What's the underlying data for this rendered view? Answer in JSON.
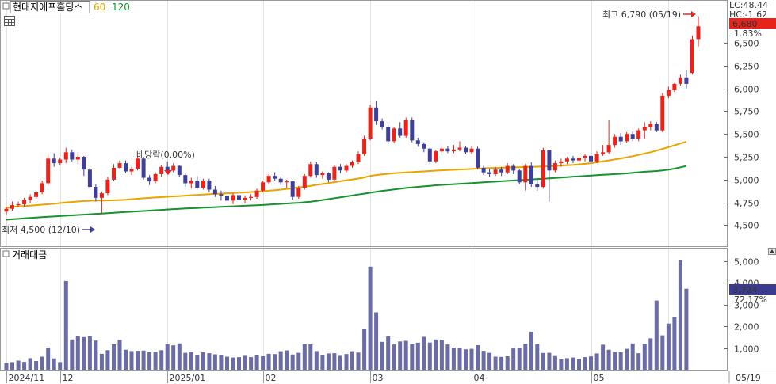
{
  "header": {
    "stock_name": "현대지에프홀딩스",
    "ma60_label": "60",
    "ma120_label": "120",
    "checkbox_icon": "checkbox-icon",
    "table_icon": "table-grid-icon"
  },
  "price_panel": {
    "lc_text": "LC:48.44",
    "hc_text": "HC:-1.62",
    "current_price": "6,680",
    "current_change": "1.83%",
    "high_annotation": "최고 6,790 (05/19)",
    "low_annotation": "최저 4,500 (12/10)",
    "dividend_annotation": "배당락(0.00%)"
  },
  "volume_panel": {
    "title": "거래대금",
    "current_value": "3,724",
    "current_change": "72.17%"
  },
  "colors": {
    "up": "#e8231b",
    "down": "#3f3f9a",
    "ma60": "#e8a400",
    "ma120": "#16922e",
    "volume_bar": "#6b6ba5",
    "price_tag_bg": "#e8231b",
    "volume_tag_bg": "#3b3b8f"
  },
  "chart_data": {
    "type": "candlestick",
    "price_axis": {
      "ticks": [
        4500,
        4750,
        5000,
        5250,
        5500,
        5750,
        6000,
        6250,
        6500
      ],
      "range": [
        4330,
        6900
      ]
    },
    "volume_axis": {
      "ticks": [
        1000,
        2000,
        3000,
        4000,
        5000
      ],
      "range": [
        0,
        5350
      ]
    },
    "x_labels": [
      {
        "label": "2024/11",
        "index": 0
      },
      {
        "label": "12",
        "index": 9
      },
      {
        "label": "2025/01",
        "index": 27
      },
      {
        "label": "02",
        "index": 43
      },
      {
        "label": "03",
        "index": 61
      },
      {
        "label": "04",
        "index": 78
      },
      {
        "label": "05",
        "index": 98
      },
      {
        "label": "05/19",
        "index": 111
      }
    ],
    "candles": [
      [
        4650,
        4700,
        4620,
        4680
      ],
      [
        4680,
        4760,
        4660,
        4720
      ],
      [
        4720,
        4760,
        4700,
        4730
      ],
      [
        4730,
        4800,
        4700,
        4780
      ],
      [
        4780,
        4840,
        4740,
        4810
      ],
      [
        4810,
        4880,
        4790,
        4860
      ],
      [
        4860,
        4990,
        4840,
        4960
      ],
      [
        4960,
        5270,
        4940,
        5230
      ],
      [
        5230,
        5290,
        5140,
        5180
      ],
      [
        5180,
        5240,
        5160,
        5220
      ],
      [
        5220,
        5350,
        5180,
        5300
      ],
      [
        5300,
        5330,
        5200,
        5220
      ],
      [
        5220,
        5280,
        5170,
        5250
      ],
      [
        5250,
        5260,
        5040,
        5110
      ],
      [
        5110,
        5130,
        4900,
        4920
      ],
      [
        4920,
        4950,
        4760,
        4800
      ],
      [
        4800,
        4870,
        4630,
        4850
      ],
      [
        4850,
        5030,
        4830,
        5000
      ],
      [
        5000,
        5170,
        4990,
        5130
      ],
      [
        5130,
        5210,
        5120,
        5180
      ],
      [
        5180,
        5210,
        5070,
        5090
      ],
      [
        5090,
        5140,
        5050,
        5120
      ],
      [
        5120,
        5260,
        5100,
        5230
      ],
      [
        5230,
        5250,
        5000,
        5020
      ],
      [
        5020,
        5050,
        4940,
        4980
      ],
      [
        4980,
        5080,
        4960,
        5060
      ],
      [
        5060,
        5160,
        5030,
        5140
      ],
      [
        5140,
        5200,
        5070,
        5100
      ],
      [
        5100,
        5180,
        5080,
        5150
      ],
      [
        5150,
        5160,
        5030,
        5050
      ],
      [
        5050,
        5070,
        4920,
        4960
      ],
      [
        4960,
        5020,
        4900,
        4990
      ],
      [
        4990,
        5040,
        4900,
        4910
      ],
      [
        4910,
        5010,
        4890,
        4990
      ],
      [
        4990,
        5010,
        4860,
        4890
      ],
      [
        4890,
        4930,
        4810,
        4840
      ],
      [
        4840,
        4880,
        4770,
        4820
      ],
      [
        4820,
        4860,
        4760,
        4770
      ],
      [
        4770,
        4850,
        4730,
        4830
      ],
      [
        4830,
        4850,
        4760,
        4780
      ],
      [
        4780,
        4820,
        4740,
        4800
      ],
      [
        4800,
        4840,
        4770,
        4810
      ],
      [
        4810,
        4900,
        4790,
        4880
      ],
      [
        4880,
        4990,
        4860,
        4970
      ],
      [
        4970,
        5060,
        4950,
        5040
      ],
      [
        5040,
        5080,
        4990,
        5010
      ],
      [
        5010,
        5030,
        4940,
        4970
      ],
      [
        4970,
        5000,
        4910,
        4980
      ],
      [
        4980,
        4990,
        4780,
        4810
      ],
      [
        4810,
        4930,
        4790,
        4910
      ],
      [
        4910,
        5060,
        4890,
        5040
      ],
      [
        5040,
        5200,
        5020,
        5170
      ],
      [
        5170,
        5190,
        5020,
        5050
      ],
      [
        5050,
        5090,
        5010,
        5070
      ],
      [
        5070,
        5080,
        4970,
        5000
      ],
      [
        5000,
        5160,
        4980,
        5140
      ],
      [
        5140,
        5170,
        5070,
        5100
      ],
      [
        5100,
        5170,
        5080,
        5150
      ],
      [
        5150,
        5210,
        5130,
        5190
      ],
      [
        5190,
        5310,
        5170,
        5280
      ],
      [
        5280,
        5480,
        5260,
        5450
      ],
      [
        5450,
        5820,
        5430,
        5790
      ],
      [
        5790,
        5860,
        5600,
        5640
      ],
      [
        5640,
        5670,
        5550,
        5580
      ],
      [
        5580,
        5600,
        5390,
        5420
      ],
      [
        5420,
        5580,
        5400,
        5560
      ],
      [
        5560,
        5630,
        5460,
        5480
      ],
      [
        5480,
        5680,
        5460,
        5650
      ],
      [
        5650,
        5680,
        5410,
        5430
      ],
      [
        5430,
        5460,
        5360,
        5390
      ],
      [
        5390,
        5410,
        5300,
        5340
      ],
      [
        5340,
        5350,
        5170,
        5200
      ],
      [
        5200,
        5330,
        5180,
        5310
      ],
      [
        5310,
        5360,
        5290,
        5340
      ],
      [
        5340,
        5370,
        5290,
        5310
      ],
      [
        5310,
        5380,
        5290,
        5330
      ],
      [
        5330,
        5420,
        5310,
        5350
      ],
      [
        5350,
        5370,
        5280,
        5300
      ],
      [
        5300,
        5370,
        5280,
        5340
      ],
      [
        5340,
        5360,
        5110,
        5130
      ],
      [
        5130,
        5150,
        5050,
        5080
      ],
      [
        5080,
        5120,
        5030,
        5060
      ],
      [
        5060,
        5140,
        5040,
        5110
      ],
      [
        5110,
        5140,
        5040,
        5080
      ],
      [
        5080,
        5180,
        5060,
        5150
      ],
      [
        5150,
        5170,
        5060,
        5100
      ],
      [
        5100,
        5120,
        4950,
        4970
      ],
      [
        4970,
        5170,
        4880,
        5150
      ],
      [
        5150,
        5190,
        4920,
        4950
      ],
      [
        4950,
        5000,
        4880,
        4920
      ],
      [
        4920,
        5350,
        4900,
        5320
      ],
      [
        5320,
        5330,
        4760,
        5100
      ],
      [
        5100,
        5210,
        5080,
        5180
      ],
      [
        5180,
        5230,
        5140,
        5200
      ],
      [
        5200,
        5250,
        5170,
        5230
      ],
      [
        5230,
        5260,
        5180,
        5210
      ],
      [
        5210,
        5260,
        5190,
        5240
      ],
      [
        5240,
        5280,
        5200,
        5260
      ],
      [
        5260,
        5270,
        5180,
        5200
      ],
      [
        5200,
        5310,
        5180,
        5280
      ],
      [
        5280,
        5380,
        5260,
        5300
      ],
      [
        5300,
        5650,
        5280,
        5380
      ],
      [
        5380,
        5500,
        5350,
        5470
      ],
      [
        5470,
        5510,
        5380,
        5420
      ],
      [
        5420,
        5520,
        5400,
        5500
      ],
      [
        5500,
        5530,
        5420,
        5450
      ],
      [
        5450,
        5560,
        5420,
        5540
      ],
      [
        5540,
        5630,
        5450,
        5580
      ],
      [
        5580,
        5640,
        5540,
        5610
      ],
      [
        5610,
        5630,
        5520,
        5540
      ],
      [
        5540,
        5950,
        5520,
        5920
      ],
      [
        5920,
        6020,
        5890,
        5980
      ],
      [
        5980,
        6060,
        5960,
        6050
      ],
      [
        6050,
        6150,
        6030,
        6120
      ],
      [
        6120,
        6200,
        6000,
        6050
      ],
      [
        6170,
        6580,
        6150,
        6540
      ],
      [
        6540,
        6790,
        6460,
        6680
      ]
    ],
    "volume": [
      310,
      350,
      420,
      360,
      530,
      400,
      600,
      1010,
      520,
      350,
      4080,
      1390,
      1550,
      1500,
      1540,
      1340,
      730,
      900,
      1170,
      1370,
      920,
      860,
      870,
      880,
      810,
      820,
      900,
      1170,
      1120,
      1210,
      780,
      810,
      690,
      800,
      760,
      710,
      680,
      600,
      560,
      580,
      640,
      580,
      660,
      620,
      730,
      720,
      850,
      890,
      700,
      780,
      1180,
      1170,
      860,
      690,
      750,
      760,
      640,
      720,
      850,
      790,
      1860,
      4740,
      2640,
      1280,
      1530,
      1160,
      1300,
      1330,
      1180,
      1240,
      1510,
      1250,
      1390,
      1380,
      1160,
      1020,
      990,
      940,
      960,
      1130,
      870,
      780,
      600,
      590,
      620,
      980,
      1000,
      1190,
      1750,
      1170,
      770,
      780,
      630,
      510,
      530,
      560,
      510,
      580,
      610,
      750,
      1150,
      920,
      820,
      800,
      960,
      1210,
      760,
      1190,
      1440,
      3180,
      1580,
      2120,
      2420,
      5040,
      3724
    ],
    "ma60": [
      4690,
      4700,
      4705,
      4710,
      4715,
      4720,
      4725,
      4730,
      4735,
      4742,
      4750,
      4755,
      4760,
      4765,
      4768,
      4770,
      4770,
      4772,
      4774,
      4776,
      4780,
      4785,
      4790,
      4795,
      4800,
      4804,
      4808,
      4812,
      4816,
      4820,
      4824,
      4828,
      4832,
      4836,
      4840,
      4843,
      4846,
      4850,
      4853,
      4856,
      4860,
      4864,
      4868,
      4872,
      4878,
      4884,
      4890,
      4898,
      4906,
      4914,
      4922,
      4932,
      4942,
      4952,
      4962,
      4972,
      4982,
      4992,
      5002,
      5012,
      5024,
      5040,
      5050,
      5058,
      5064,
      5070,
      5074,
      5078,
      5082,
      5086,
      5090,
      5094,
      5098,
      5102,
      5105,
      5108,
      5111,
      5114,
      5117,
      5120,
      5123,
      5126,
      5128,
      5130,
      5132,
      5134,
      5136,
      5138,
      5140,
      5142,
      5144,
      5146,
      5150,
      5154,
      5158,
      5162,
      5167,
      5173,
      5180,
      5190,
      5200,
      5210,
      5222,
      5232,
      5244,
      5256,
      5270,
      5286,
      5300,
      5318,
      5336,
      5356,
      5376,
      5396,
      5416
    ],
    "ma120": [
      4560,
      4565,
      4570,
      4575,
      4580,
      4584,
      4588,
      4592,
      4596,
      4600,
      4604,
      4608,
      4612,
      4616,
      4620,
      4624,
      4628,
      4632,
      4636,
      4640,
      4644,
      4648,
      4652,
      4656,
      4660,
      4664,
      4668,
      4672,
      4676,
      4680,
      4683,
      4686,
      4689,
      4692,
      4695,
      4698,
      4701,
      4704,
      4707,
      4710,
      4713,
      4716,
      4719,
      4722,
      4726,
      4730,
      4734,
      4738,
      4742,
      4746,
      4752,
      4758,
      4766,
      4776,
      4786,
      4796,
      4806,
      4816,
      4826,
      4836,
      4846,
      4856,
      4866,
      4876,
      4884,
      4892,
      4900,
      4908,
      4914,
      4920,
      4926,
      4932,
      4938,
      4942,
      4946,
      4950,
      4954,
      4958,
      4962,
      4966,
      4970,
      4974,
      4978,
      4982,
      4986,
      4990,
      4994,
      4998,
      5002,
      5006,
      5010,
      5014,
      5018,
      5022,
      5027,
      5032,
      5036,
      5040,
      5044,
      5048,
      5052,
      5056,
      5060,
      5064,
      5068,
      5074,
      5080,
      5086,
      5090,
      5094,
      5100,
      5110,
      5120,
      5135,
      5150
    ]
  }
}
